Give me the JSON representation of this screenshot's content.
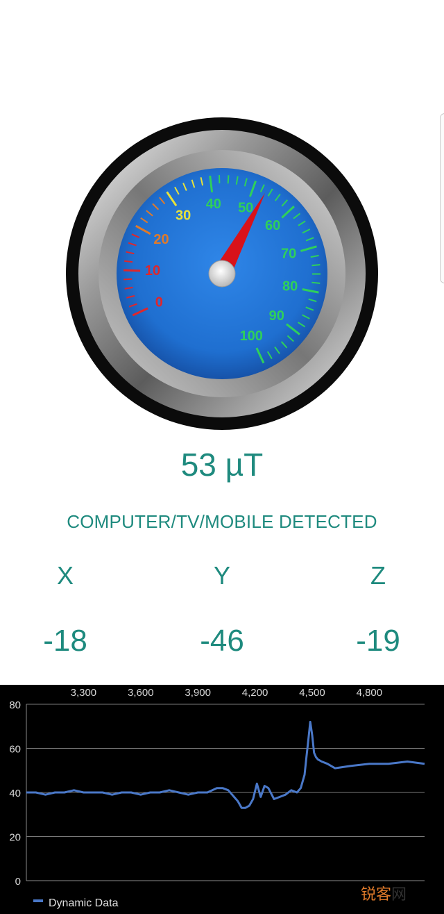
{
  "gauge": {
    "min": 0,
    "max": 100,
    "needle_value": 53,
    "scale_labels": [
      "0",
      "10",
      "20",
      "30",
      "40",
      "50",
      "60",
      "70",
      "80",
      "90",
      "100"
    ],
    "colors": {
      "face": "#1f6fd0",
      "rim_dark": "#0b0b0b",
      "needle": "#d8121a",
      "low": "#e0262a",
      "mid_low": "#e07a2a",
      "mid": "#e8e23a",
      "high": "#2fd05a"
    }
  },
  "reading": {
    "text": "53 µT"
  },
  "status": {
    "text": "COMPUTER/TV/MOBILE DETECTED"
  },
  "axes": [
    {
      "label": "X",
      "value": "-18"
    },
    {
      "label": "Y",
      "value": "-46"
    },
    {
      "label": "Z",
      "value": "-19"
    }
  ],
  "watermark": {
    "part1": "锐客",
    "part2": "网"
  },
  "chart_data": {
    "type": "line",
    "xlim": [
      3000,
      5090
    ],
    "ylim": [
      0,
      80
    ],
    "x_ticks": [
      "3,300",
      "3,600",
      "3,900",
      "4,200",
      "4,500",
      "4,800"
    ],
    "x_tick_values": [
      3300,
      3600,
      3900,
      4200,
      4500,
      4800
    ],
    "y_ticks": [
      "80",
      "60",
      "40",
      "20",
      "0"
    ],
    "y_tick_values": [
      80,
      60,
      40,
      20,
      0
    ],
    "grid": true,
    "legend_position": "bottom-left",
    "series": [
      {
        "name": "Dynamic Data",
        "color": "#4a78c8",
        "x": [
          3000,
          3050,
          3100,
          3150,
          3200,
          3250,
          3300,
          3350,
          3400,
          3450,
          3500,
          3550,
          3600,
          3650,
          3700,
          3750,
          3800,
          3850,
          3900,
          3950,
          4000,
          4030,
          4060,
          4090,
          4110,
          4130,
          4150,
          4170,
          4190,
          4210,
          4230,
          4250,
          4270,
          4300,
          4330,
          4360,
          4390,
          4420,
          4440,
          4460,
          4470,
          4480,
          4490,
          4500,
          4510,
          4520,
          4530,
          4550,
          4580,
          4620,
          4700,
          4800,
          4900,
          5000,
          5090
        ],
        "values": [
          40,
          40,
          39,
          40,
          40,
          41,
          40,
          40,
          40,
          39,
          40,
          40,
          39,
          40,
          40,
          41,
          40,
          39,
          40,
          40,
          42,
          42,
          41,
          38,
          36,
          33,
          33,
          34,
          37,
          44,
          38,
          43,
          42,
          37,
          38,
          39,
          41,
          40,
          42,
          48,
          56,
          64,
          72,
          66,
          58,
          56,
          55,
          54,
          53,
          51,
          52,
          53,
          53,
          54,
          53
        ]
      }
    ]
  }
}
